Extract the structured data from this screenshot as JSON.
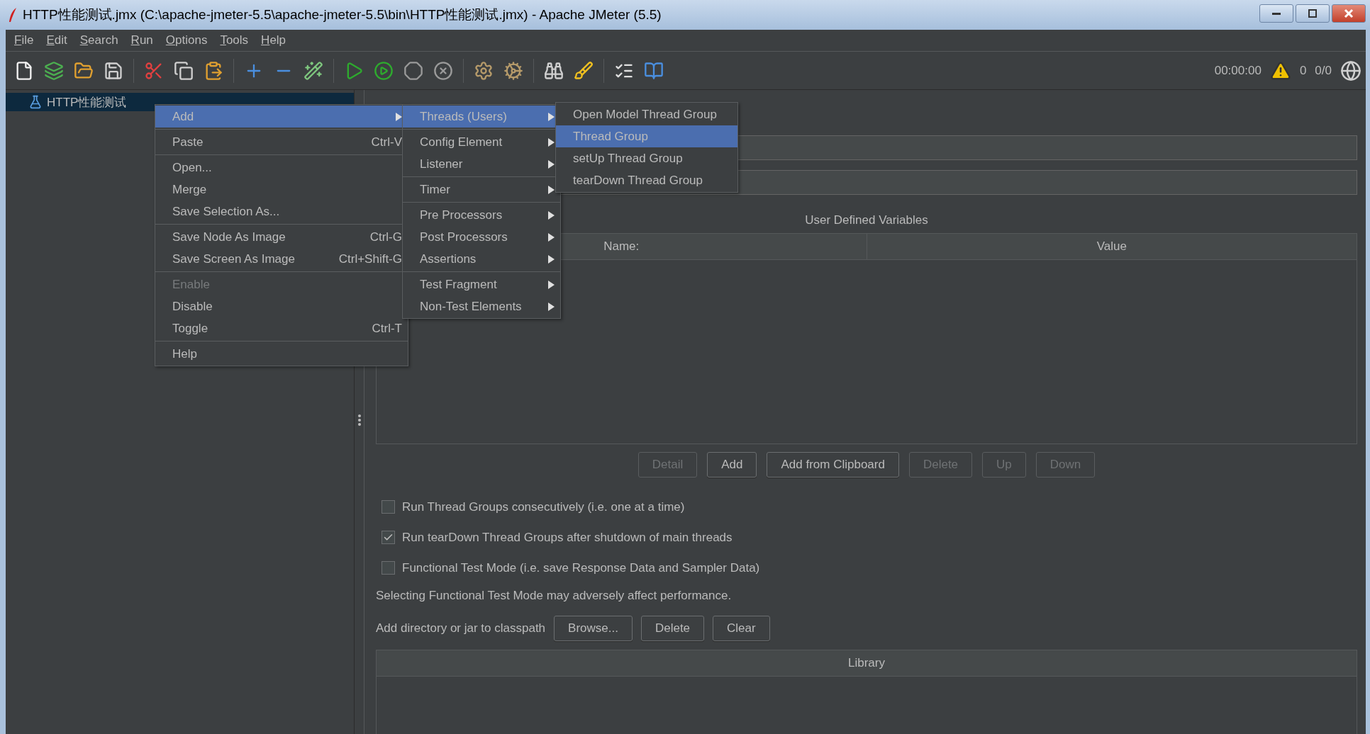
{
  "window": {
    "title": "HTTP性能测试.jmx (C:\\apache-jmeter-5.5\\apache-jmeter-5.5\\bin\\HTTP性能测试.jmx) - Apache JMeter (5.5)"
  },
  "menu_bar": [
    {
      "label": "File"
    },
    {
      "label": "Edit"
    },
    {
      "label": "Search"
    },
    {
      "label": "Run"
    },
    {
      "label": "Options"
    },
    {
      "label": "Tools"
    },
    {
      "label": "Help"
    }
  ],
  "status": {
    "time": "00:00:00",
    "warnings": "0",
    "threads": "0/0"
  },
  "tree": {
    "items": [
      {
        "label": "HTTP性能测试",
        "selected": true
      }
    ]
  },
  "context_menu": {
    "items": [
      {
        "kind": "submenu",
        "label": "Add",
        "selected": true,
        "disabled": false
      },
      {
        "kind": "separator"
      },
      {
        "kind": "item",
        "label": "Paste",
        "shortcut": "Ctrl-V",
        "selected": false,
        "disabled": false
      },
      {
        "kind": "separator"
      },
      {
        "kind": "item",
        "label": "Open...",
        "selected": false,
        "disabled": false
      },
      {
        "kind": "item",
        "label": "Merge",
        "selected": false,
        "disabled": false
      },
      {
        "kind": "item",
        "label": "Save Selection As...",
        "selected": false,
        "disabled": false
      },
      {
        "kind": "separator"
      },
      {
        "kind": "item",
        "label": "Save Node As Image",
        "shortcut": "Ctrl-G",
        "selected": false,
        "disabled": false
      },
      {
        "kind": "item",
        "label": "Save Screen As Image",
        "shortcut": "Ctrl+Shift-G",
        "selected": false,
        "disabled": false
      },
      {
        "kind": "separator"
      },
      {
        "kind": "item",
        "label": "Enable",
        "selected": false,
        "disabled": true
      },
      {
        "kind": "item",
        "label": "Disable",
        "selected": false,
        "disabled": false
      },
      {
        "kind": "item",
        "label": "Toggle",
        "shortcut": "Ctrl-T",
        "selected": false,
        "disabled": false
      },
      {
        "kind": "separator"
      },
      {
        "kind": "item",
        "label": "Help",
        "selected": false,
        "disabled": false
      }
    ]
  },
  "add_submenu": {
    "items": [
      {
        "kind": "submenu",
        "label": "Threads (Users)",
        "selected": true,
        "disabled": false
      },
      {
        "kind": "separator"
      },
      {
        "kind": "submenu",
        "label": "Config Element",
        "selected": false,
        "disabled": false
      },
      {
        "kind": "submenu",
        "label": "Listener",
        "selected": false,
        "disabled": false
      },
      {
        "kind": "separator"
      },
      {
        "kind": "submenu",
        "label": "Timer",
        "selected": false,
        "disabled": false
      },
      {
        "kind": "separator"
      },
      {
        "kind": "submenu",
        "label": "Pre Processors",
        "selected": false,
        "disabled": false
      },
      {
        "kind": "submenu",
        "label": "Post Processors",
        "selected": false,
        "disabled": false
      },
      {
        "kind": "submenu",
        "label": "Assertions",
        "selected": false,
        "disabled": false
      },
      {
        "kind": "separator"
      },
      {
        "kind": "submenu",
        "label": "Test Fragment",
        "selected": false,
        "disabled": false
      },
      {
        "kind": "submenu",
        "label": "Non-Test Elements",
        "selected": false,
        "disabled": false
      }
    ]
  },
  "threads_submenu": {
    "items": [
      {
        "kind": "item",
        "label": "Open Model Thread Group",
        "selected": false,
        "disabled": false
      },
      {
        "kind": "item",
        "label": "Thread Group",
        "selected": true,
        "disabled": false
      },
      {
        "kind": "item",
        "label": "setUp Thread Group",
        "selected": false,
        "disabled": false
      },
      {
        "kind": "item",
        "label": "tearDown Thread Group",
        "selected": false,
        "disabled": false
      }
    ]
  },
  "variables_table": {
    "title": "User Defined Variables",
    "columns": [
      "Name:",
      "Value"
    ]
  },
  "table_buttons": [
    {
      "label": "Detail",
      "disabled": true
    },
    {
      "label": "Add",
      "disabled": false
    },
    {
      "label": "Add from Clipboard",
      "disabled": false
    },
    {
      "label": "Delete",
      "disabled": true
    },
    {
      "label": "Up",
      "disabled": true
    },
    {
      "label": "Down",
      "disabled": true
    }
  ],
  "options": [
    {
      "label": "Run Thread Groups consecutively (i.e. one at a time)",
      "checked": false
    },
    {
      "label": "Run tearDown Thread Groups after shutdown of main threads",
      "checked": true
    },
    {
      "label": "Functional Test Mode (i.e. save Response Data and Sampler Data)",
      "checked": false
    }
  ],
  "note": "Selecting Functional Test Mode may adversely affect performance.",
  "classpath": {
    "label": "Add directory or jar to classpath",
    "buttons": [
      "Browse...",
      "Delete",
      "Clear"
    ]
  },
  "library_table": {
    "columns": [
      "Library"
    ]
  }
}
